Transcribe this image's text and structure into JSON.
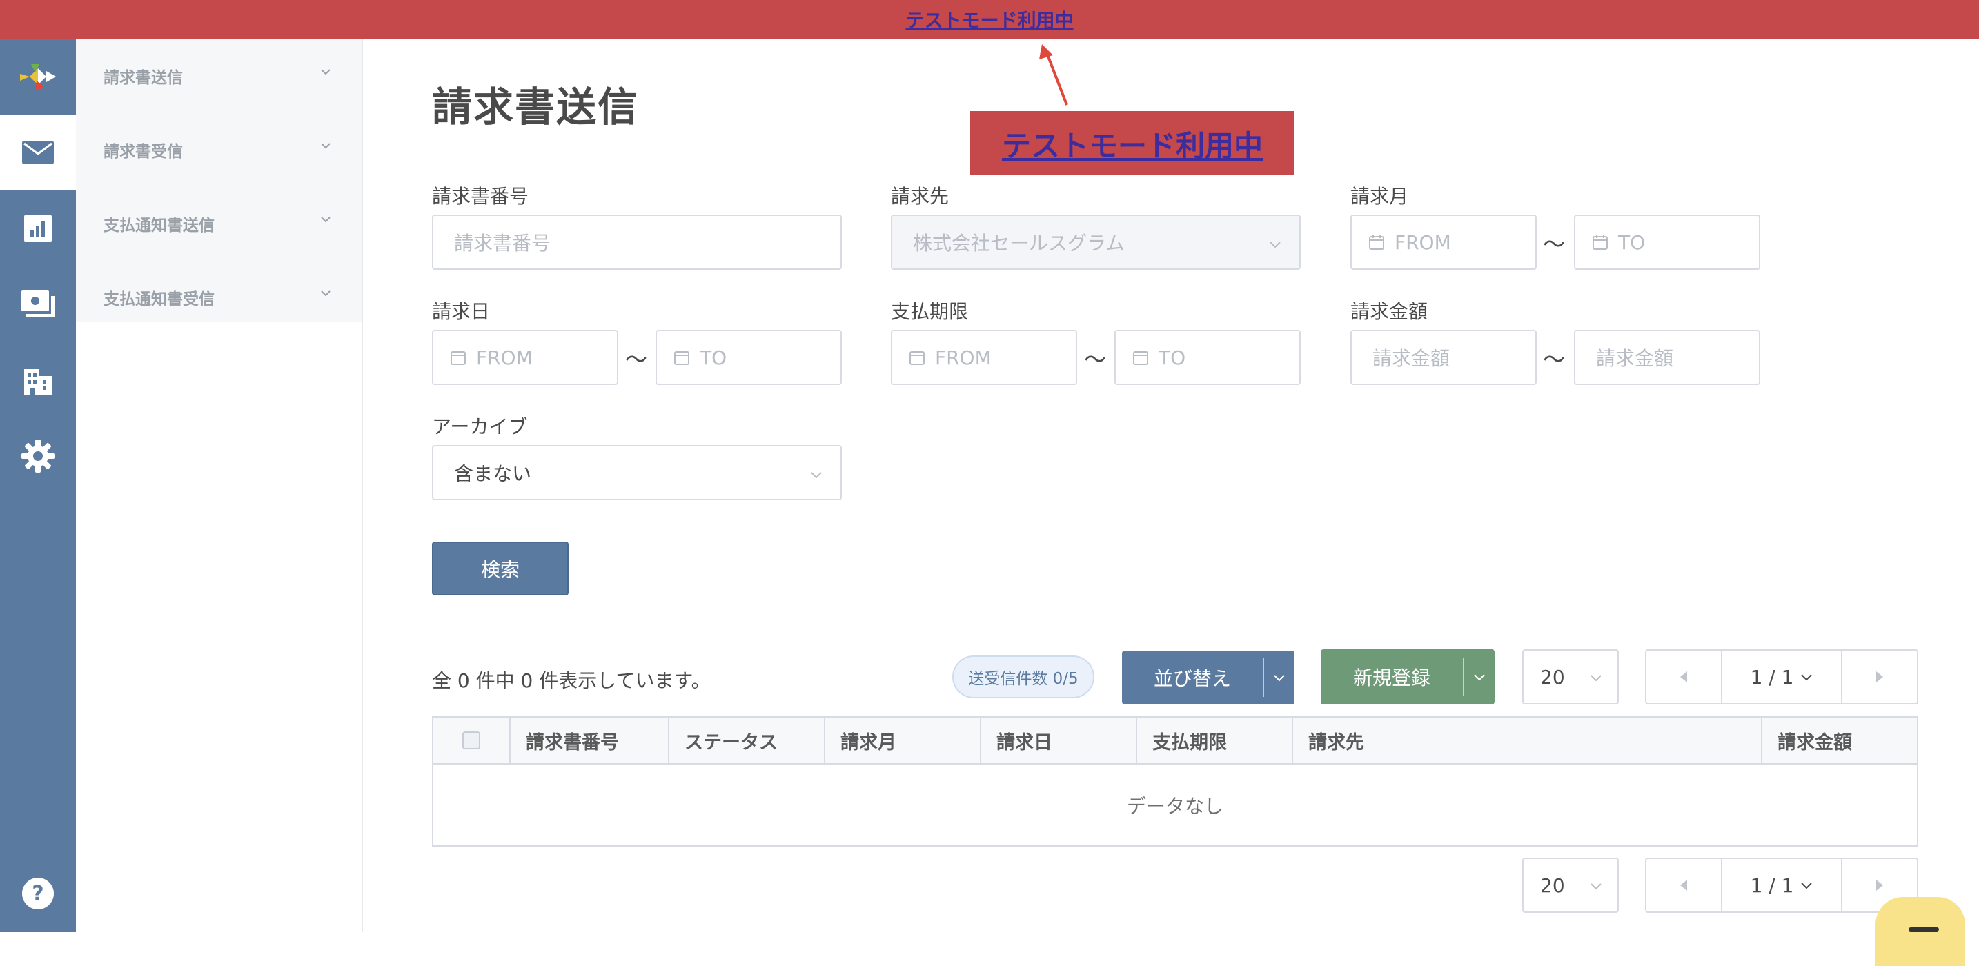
{
  "banner": {
    "text": "テストモード利用中"
  },
  "callout": {
    "text": "テストモード利用中"
  },
  "rail": {
    "items": [
      {
        "icon": "logo-icon"
      },
      {
        "icon": "mail-icon",
        "active": true
      },
      {
        "icon": "chart-icon"
      },
      {
        "icon": "payment-icon"
      },
      {
        "icon": "building-icon"
      },
      {
        "icon": "gear-icon"
      },
      {
        "icon": "help-icon"
      }
    ]
  },
  "sidenav": {
    "items": [
      {
        "label": "請求書送信"
      },
      {
        "label": "請求書受信"
      },
      {
        "label": "支払通知書送信"
      },
      {
        "label": "支払通知書受信"
      }
    ]
  },
  "page": {
    "title": "請求書送信"
  },
  "form": {
    "invoice_number": {
      "label": "請求書番号",
      "placeholder": "請求書番号"
    },
    "recipient": {
      "label": "請求先",
      "value": "株式会社セールスグラム"
    },
    "billing_month": {
      "label": "請求月",
      "from": "FROM",
      "to": "TO"
    },
    "invoice_date": {
      "label": "請求日",
      "from": "FROM",
      "to": "TO"
    },
    "due_date": {
      "label": "支払期限",
      "from": "FROM",
      "to": "TO"
    },
    "amount": {
      "label": "請求金額",
      "from_placeholder": "請求金額",
      "to_placeholder": "請求金額"
    },
    "archive": {
      "label": "アーカイブ",
      "value": "含まない"
    },
    "tilde": "〜",
    "search_button": "検索"
  },
  "results": {
    "summary": "全 0 件中 0 件表示しています。",
    "count_badge": "送受信件数 0/5",
    "sort_button": "並び替え",
    "new_button": "新規登録",
    "page_size": "20",
    "page_indicator": "1 / 1"
  },
  "table": {
    "columns": [
      "請求書番号",
      "ステータス",
      "請求月",
      "請求日",
      "支払期限",
      "請求先",
      "請求金額"
    ],
    "empty_text": "データなし"
  },
  "colors": {
    "banner": "#c5484a",
    "rail": "#5b7aa0",
    "sort_button": "#5b7aa0",
    "new_button": "#6e9a78"
  }
}
